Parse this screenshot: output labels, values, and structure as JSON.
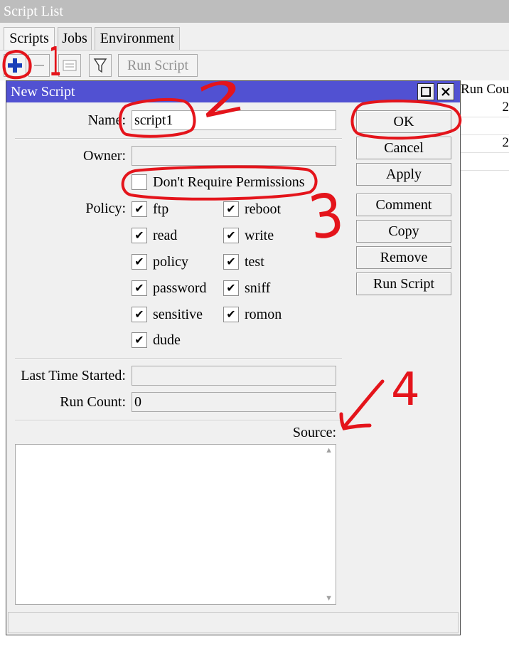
{
  "window": {
    "title": "Script List"
  },
  "tabs": [
    {
      "label": "Scripts",
      "active": true
    },
    {
      "label": "Jobs",
      "active": false
    },
    {
      "label": "Environment",
      "active": false
    }
  ],
  "toolbar": {
    "add_icon": "plus-icon",
    "remove_icon": "minus-icon",
    "comment_icon": "note-icon",
    "filter_icon": "filter-icon",
    "run_script_label": "Run Script"
  },
  "list": {
    "column_header": "Run Count",
    "cells": [
      "2",
      "2"
    ]
  },
  "dialog": {
    "title": "New Script",
    "name_label": "Name:",
    "name_value": "script1",
    "owner_label": "Owner:",
    "owner_value": "",
    "dont_require_permissions": {
      "label": "Don't Require Permissions",
      "checked": false
    },
    "policy_label": "Policy:",
    "policies": [
      {
        "label": "ftp",
        "checked": true
      },
      {
        "label": "reboot",
        "checked": true
      },
      {
        "label": "read",
        "checked": true
      },
      {
        "label": "write",
        "checked": true
      },
      {
        "label": "policy",
        "checked": true
      },
      {
        "label": "test",
        "checked": true
      },
      {
        "label": "password",
        "checked": true
      },
      {
        "label": "sniff",
        "checked": true
      },
      {
        "label": "sensitive",
        "checked": true
      },
      {
        "label": "romon",
        "checked": true
      },
      {
        "label": "dude",
        "checked": true
      }
    ],
    "last_time_started_label": "Last Time Started:",
    "last_time_started_value": "",
    "run_count_label": "Run Count:",
    "run_count_value": "0",
    "source_label": "Source:",
    "source_value": "",
    "buttons": {
      "ok": "OK",
      "cancel": "Cancel",
      "apply": "Apply",
      "comment": "Comment",
      "copy": "Copy",
      "remove": "Remove",
      "run_script": "Run Script"
    }
  },
  "annotations": {
    "color": "#e4141b",
    "step_1": "1",
    "step_2": "2",
    "step_3": "3",
    "step_4": "4"
  },
  "colors": {
    "dialog_title_bar": "#5151d2",
    "window_title_bar": "#bdbdbd",
    "add_icon": "#1a3fb8"
  }
}
